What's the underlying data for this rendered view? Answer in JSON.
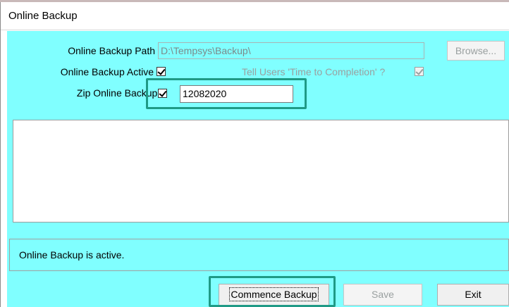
{
  "window": {
    "title": "Online Backup"
  },
  "form": {
    "path_label": "Online Backup Path",
    "path_value": "D:\\Tempsys\\Backup\\",
    "browse_label": "Browse...",
    "active_label": "Online Backup Active",
    "active_checked": true,
    "tell_users_label": "Tell Users 'Time to Completion' ?",
    "tell_users_checked": true,
    "zip_label": "Zip Online Backup ?",
    "zip_checked": true,
    "zip_value": "12082020"
  },
  "log": {
    "lines": []
  },
  "status": {
    "message": "Online Backup is active."
  },
  "buttons": {
    "commence": "Commence Backup",
    "save": "Save",
    "exit": "Exit"
  },
  "colors": {
    "client_bg": "#80ffff",
    "highlight": "#1f9a86"
  }
}
